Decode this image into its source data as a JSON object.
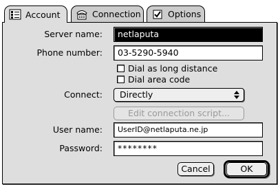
{
  "tabs": [
    {
      "label": "Account",
      "icon": "account-icon",
      "active": true
    },
    {
      "label": "Connection",
      "icon": "connection-icon",
      "active": false
    },
    {
      "label": "Options",
      "icon": "options-checkbox-icon",
      "active": false
    }
  ],
  "form": {
    "server_name_label": "Server name:",
    "server_name_value": "netlaputa",
    "phone_label": "Phone number:",
    "phone_value": "03-5290-5940",
    "dial_long_distance": {
      "label": "Dial as long distance",
      "checked": false
    },
    "dial_area_code": {
      "label": "Dial area code",
      "checked": false
    },
    "connect_label": "Connect:",
    "connect_value": "Directly",
    "edit_script_label": "Edit connection script...",
    "user_name_label": "User name:",
    "user_name_value": "UserID@netlaputa.ne.jp",
    "password_label": "Password:",
    "password_value": "********"
  },
  "buttons": {
    "cancel": "Cancel",
    "ok": "OK"
  },
  "colors": {
    "panel_bg": "#dedede",
    "disabled_text": "#9a9a9a"
  }
}
